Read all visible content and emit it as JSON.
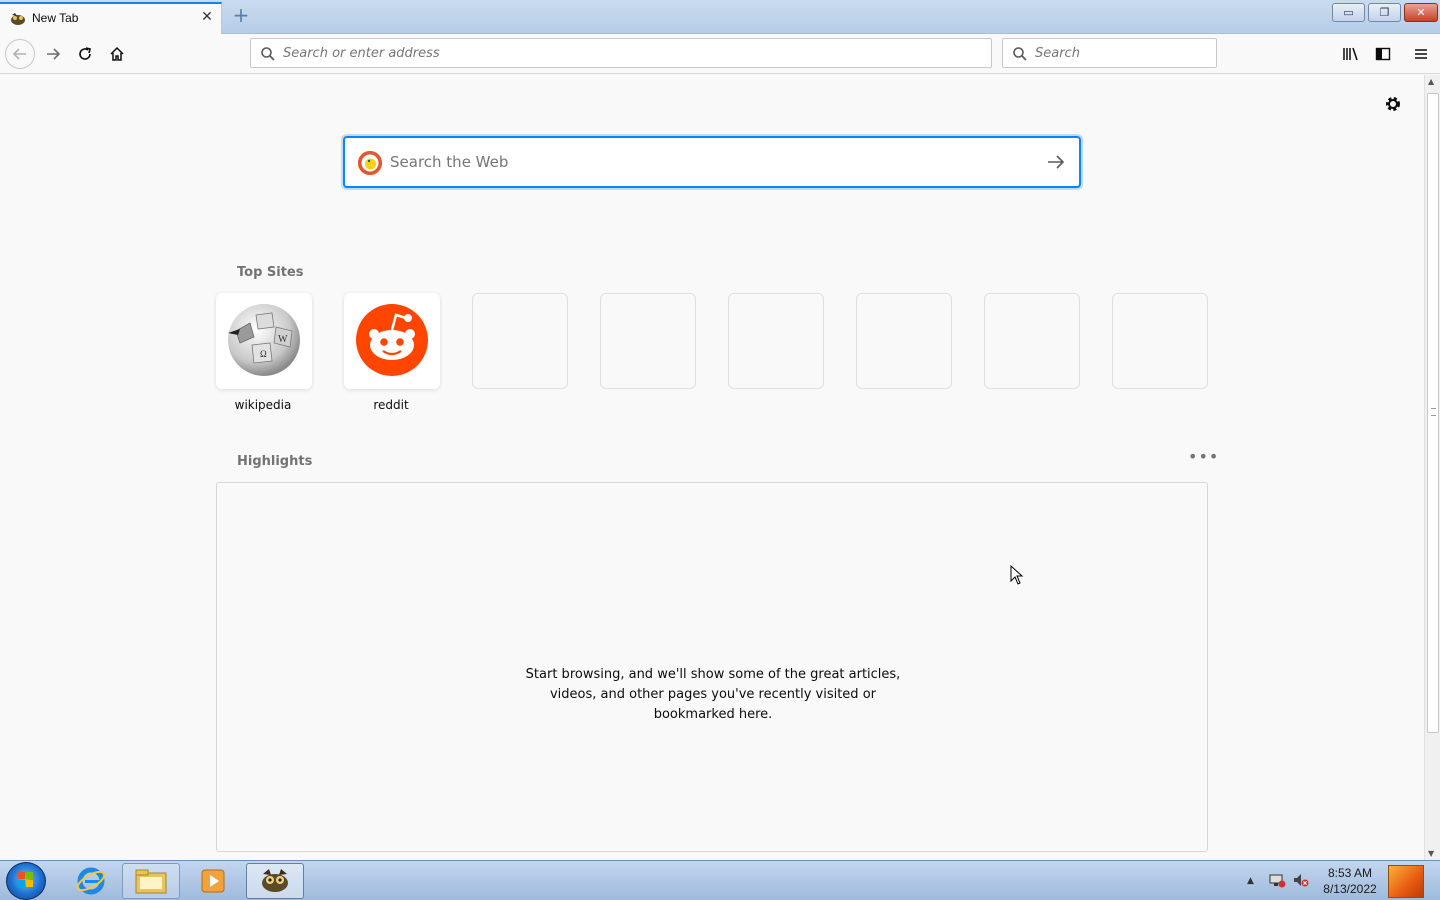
{
  "browser": {
    "tab_title": "New Tab",
    "tab_close": "✕",
    "new_tab": "+",
    "window_controls": {
      "minimize": "▭",
      "maximize": "❐",
      "close": "✕"
    },
    "address_placeholder": "Search or enter address",
    "search_placeholder": "Search"
  },
  "newtab": {
    "web_search_placeholder": "Search the Web",
    "top_sites_title": "Top Sites",
    "top_sites": [
      {
        "label": "wikipedia",
        "icon": "wikipedia-globe-icon"
      },
      {
        "label": "reddit",
        "icon": "reddit-alien-icon"
      },
      {
        "label": ""
      },
      {
        "label": ""
      },
      {
        "label": ""
      },
      {
        "label": ""
      },
      {
        "label": ""
      },
      {
        "label": ""
      }
    ],
    "highlights_title": "Highlights",
    "highlights_menu": "•••",
    "highlights_empty": "Start browsing, and we'll show some of the great articles, videos, and other pages you've recently visited or bookmarked here."
  },
  "taskbar": {
    "time": "8:53 AM",
    "date": "8/13/2022",
    "tray_arrow": "▲"
  },
  "colors": {
    "accent": "#0a84ff",
    "reddit": "#ff4500",
    "duckduckgo": "#de5833"
  }
}
